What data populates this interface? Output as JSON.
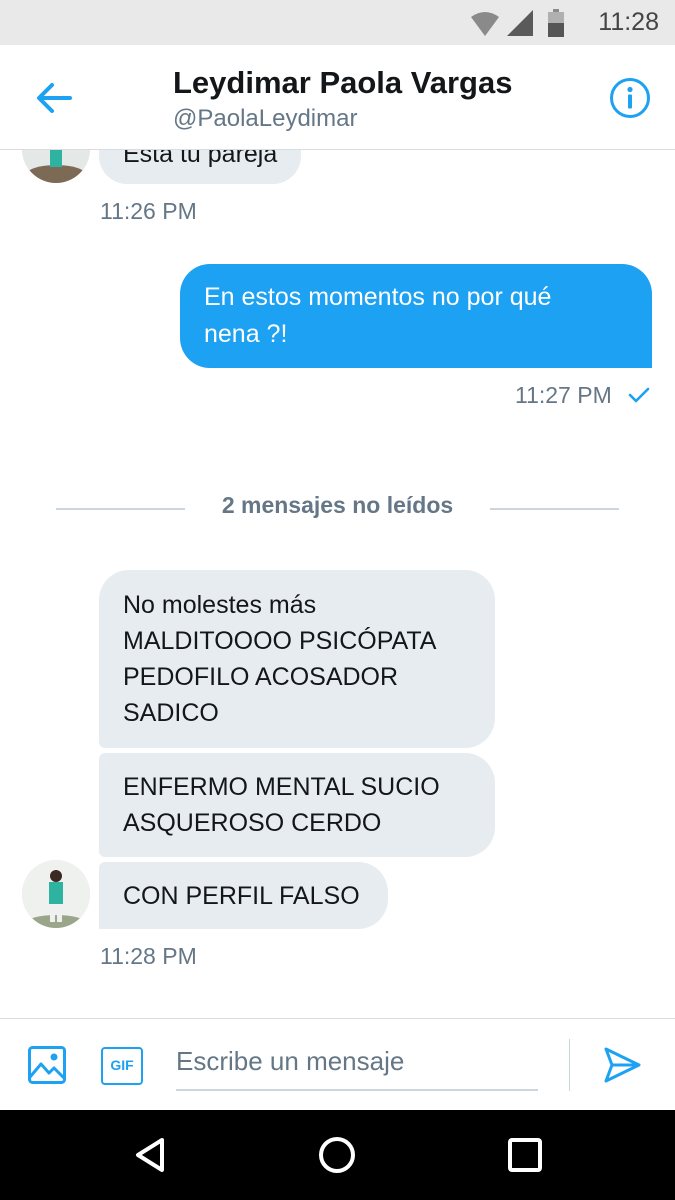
{
  "status_bar": {
    "time": "11:28"
  },
  "header": {
    "name": "Leydimar Paola Vargas",
    "handle": "@PaolaLeydimar"
  },
  "conversation": {
    "earlier_incoming": {
      "text": "Esta tu pareja",
      "time": "11:26 PM"
    },
    "outgoing": {
      "lines": [
        "En estos momentos no por qué",
        "nena ?!"
      ],
      "time": "11:27 PM",
      "status": "sent"
    },
    "unread_divider": "2 mensajes no leídos",
    "unread_messages": [
      {
        "lines": [
          "No molestes más",
          "MALDITOOOO PSICÓPATA",
          "PEDOFILO ACOSADOR",
          "SADICO"
        ]
      },
      {
        "lines": [
          "ENFERMO MENTAL SUCIO",
          "ASQUEROSO CERDO"
        ]
      },
      {
        "lines": [
          "CON PERFIL FALSO"
        ]
      }
    ],
    "last_time": "11:28 PM"
  },
  "composer": {
    "placeholder": "Escribe un mensaje",
    "gif_label": "GIF"
  },
  "colors": {
    "accent": "#1da1f2",
    "incoming_bubble": "#e6ecf0",
    "muted_text": "#657786",
    "status_bar": "#e9e9e9",
    "nav_bar": "#000000"
  },
  "icons": {
    "back": "arrow-left-icon",
    "info": "info-icon",
    "image": "image-icon",
    "gif": "gif-icon",
    "send": "send-icon",
    "sent_check": "check-icon",
    "wifi": "wifi-icon",
    "signal": "signal-icon",
    "battery": "battery-icon",
    "nav_back": "nav-back-icon",
    "nav_home": "nav-home-icon",
    "nav_recents": "nav-recents-icon"
  }
}
